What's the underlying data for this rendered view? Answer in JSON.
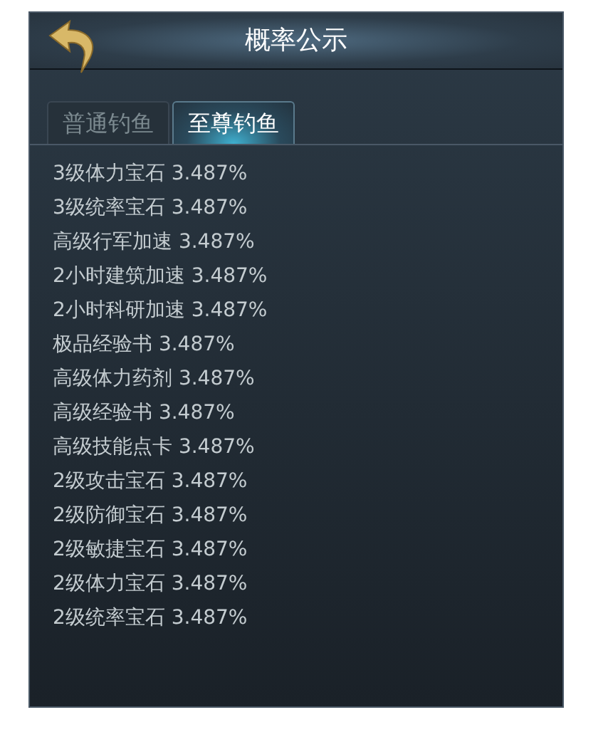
{
  "window": {
    "title": "概率公示"
  },
  "tabs": [
    {
      "label": "普通钓鱼",
      "selected": false
    },
    {
      "label": "至尊钓鱼",
      "selected": true
    }
  ],
  "items": [
    "3级体力宝石 3.487%",
    "3级统率宝石 3.487%",
    "高级行军加速 3.487%",
    "2小时建筑加速 3.487%",
    "2小时科研加速 3.487%",
    "极品经验书 3.487%",
    "高级体力药剂 3.487%",
    "高级经验书 3.487%",
    "高级技能点卡 3.487%",
    "2级攻击宝石 3.487%",
    "2级防御宝石 3.487%",
    "2级敏捷宝石 3.487%",
    "2级体力宝石 3.487%",
    "2级统率宝石 3.487%"
  ]
}
